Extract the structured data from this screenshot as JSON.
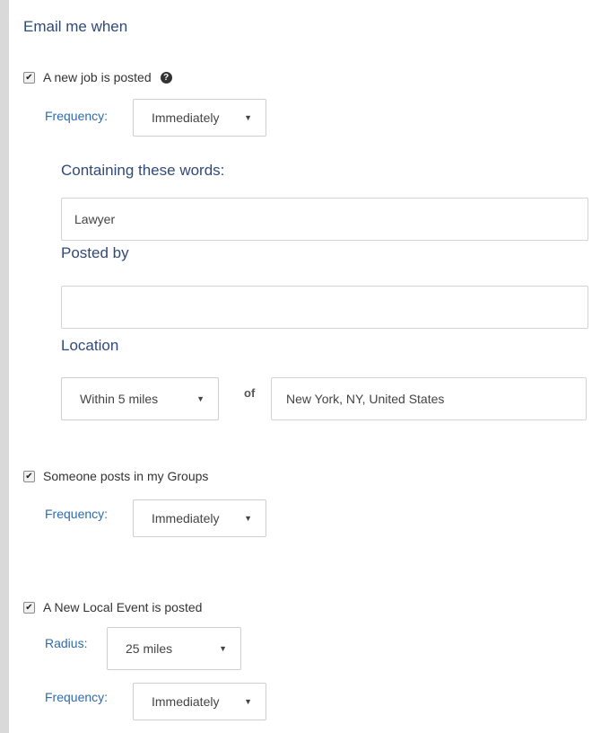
{
  "heading": "Email me when",
  "job_alert": {
    "label": "A new job is posted",
    "checked": true,
    "help_icon": "question-circle-icon",
    "frequency_label": "Frequency:",
    "frequency_value": "Immediately",
    "words_label": "Containing these words:",
    "words_value": "Lawyer",
    "posted_by_label": "Posted by",
    "posted_by_value": "",
    "location_label": "Location",
    "distance_value": "Within 5 miles",
    "of_label": "of",
    "location_value": "New York, NY, United States"
  },
  "groups_alert": {
    "label": "Someone posts in my Groups",
    "checked": true,
    "frequency_label": "Frequency:",
    "frequency_value": "Immediately"
  },
  "event_alert": {
    "label": "A New Local Event is posted",
    "checked": true,
    "radius_label": "Radius:",
    "radius_value": "25 miles",
    "frequency_label": "Frequency:",
    "frequency_value": "Immediately"
  },
  "icons": {
    "dropdown": "caret-down-icon",
    "check": "checkmark-icon"
  }
}
